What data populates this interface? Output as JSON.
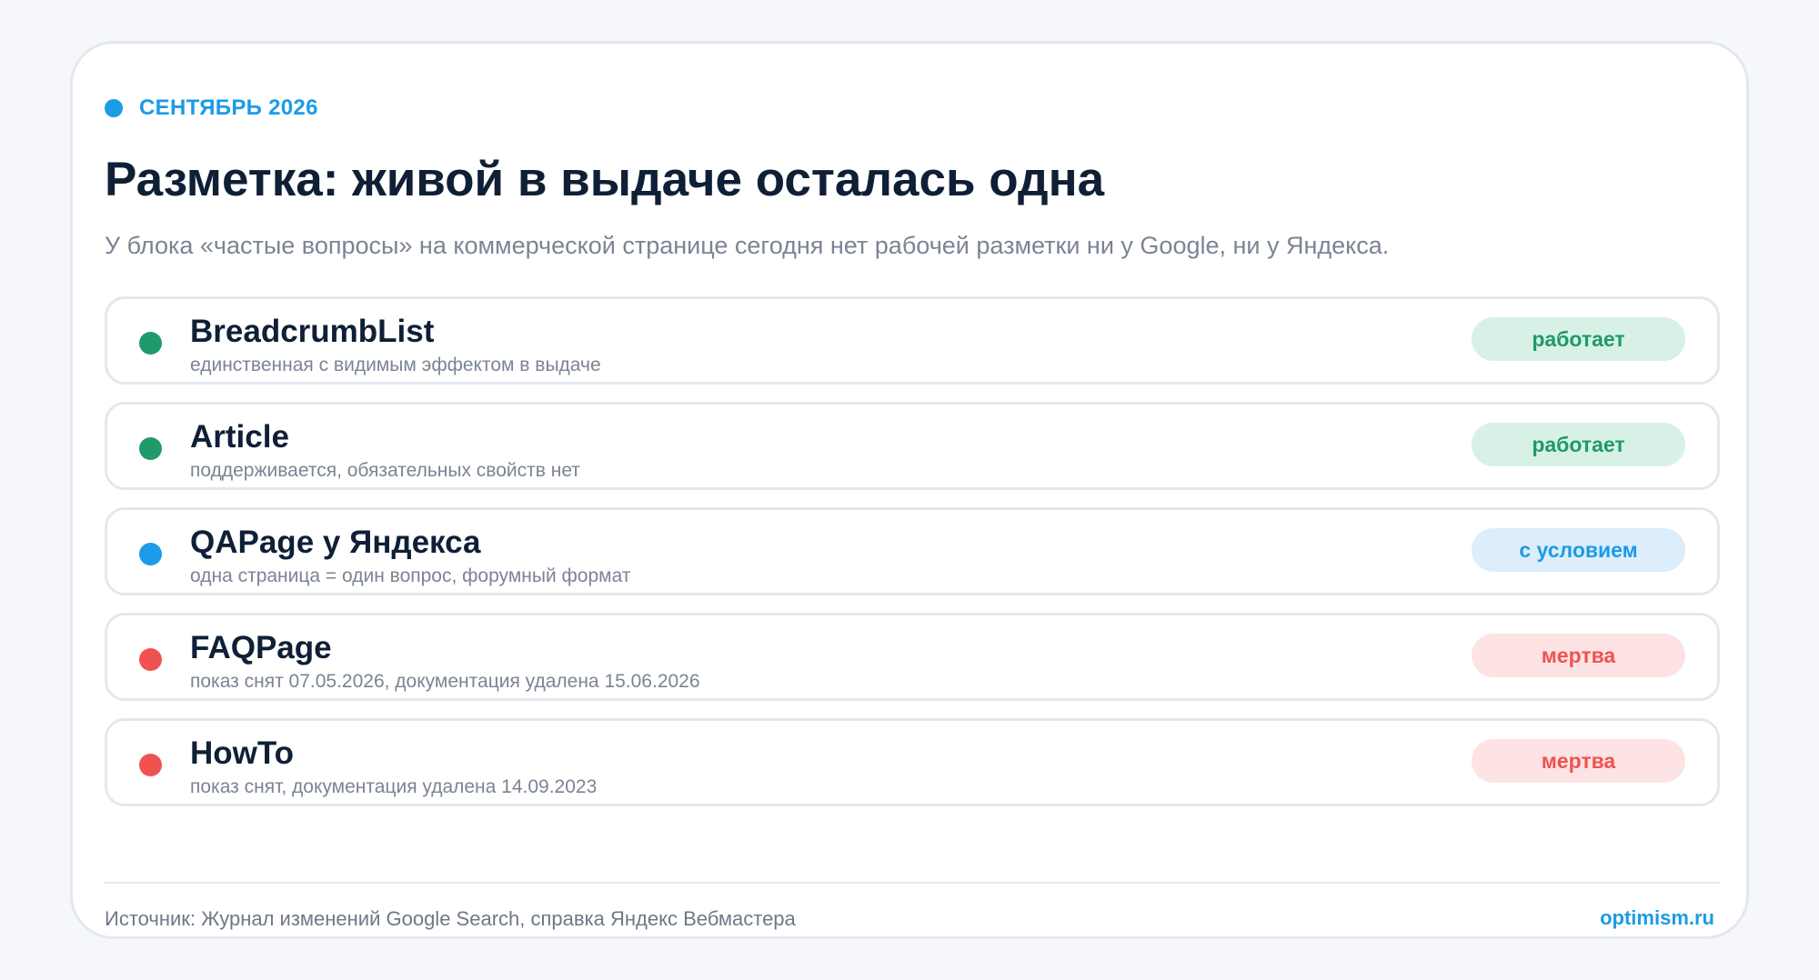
{
  "eyebrow": {
    "label": "СЕНТЯБРЬ 2026",
    "color": "#1c9be6"
  },
  "title": "Разметка: живой в выдаче осталась одна",
  "subtitle": "У блока «частые вопросы» на коммерческой странице сегодня нет рабочей разметки ни у Google, ни у Яндекса.",
  "items": [
    {
      "name": "BreadcrumbList",
      "description": "единственная с видимым эффектом в выдаче",
      "status": "работает",
      "dot_color": "#1f9a6b",
      "badge_text_color": "#1f9a6b",
      "badge_bg": "#d8f1e6"
    },
    {
      "name": "Article",
      "description": "поддерживается, обязательных свойств нет",
      "status": "работает",
      "dot_color": "#1f9a6b",
      "badge_text_color": "#1f9a6b",
      "badge_bg": "#d8f1e6"
    },
    {
      "name": "QAPage у Яндекса",
      "description": "одна страница = один вопрос, форумный формат",
      "status": "с условием",
      "dot_color": "#1c9be6",
      "badge_text_color": "#1c9be6",
      "badge_bg": "#dcedfb"
    },
    {
      "name": "FAQPage",
      "description": "показ снят 07.05.2026, документация удалена 15.06.2026",
      "status": "мертва",
      "dot_color": "#f05252",
      "badge_text_color": "#f05252",
      "badge_bg": "#fde3e3"
    },
    {
      "name": "HowTo",
      "description": "показ снят, документация удалена 14.09.2023",
      "status": "мертва",
      "dot_color": "#f05252",
      "badge_text_color": "#f05252",
      "badge_bg": "#fde3e3"
    }
  ],
  "footer": {
    "source": "Источник: Журнал изменений Google Search, справка Яндекс Вебмастера",
    "brand": "optimism.ru"
  }
}
